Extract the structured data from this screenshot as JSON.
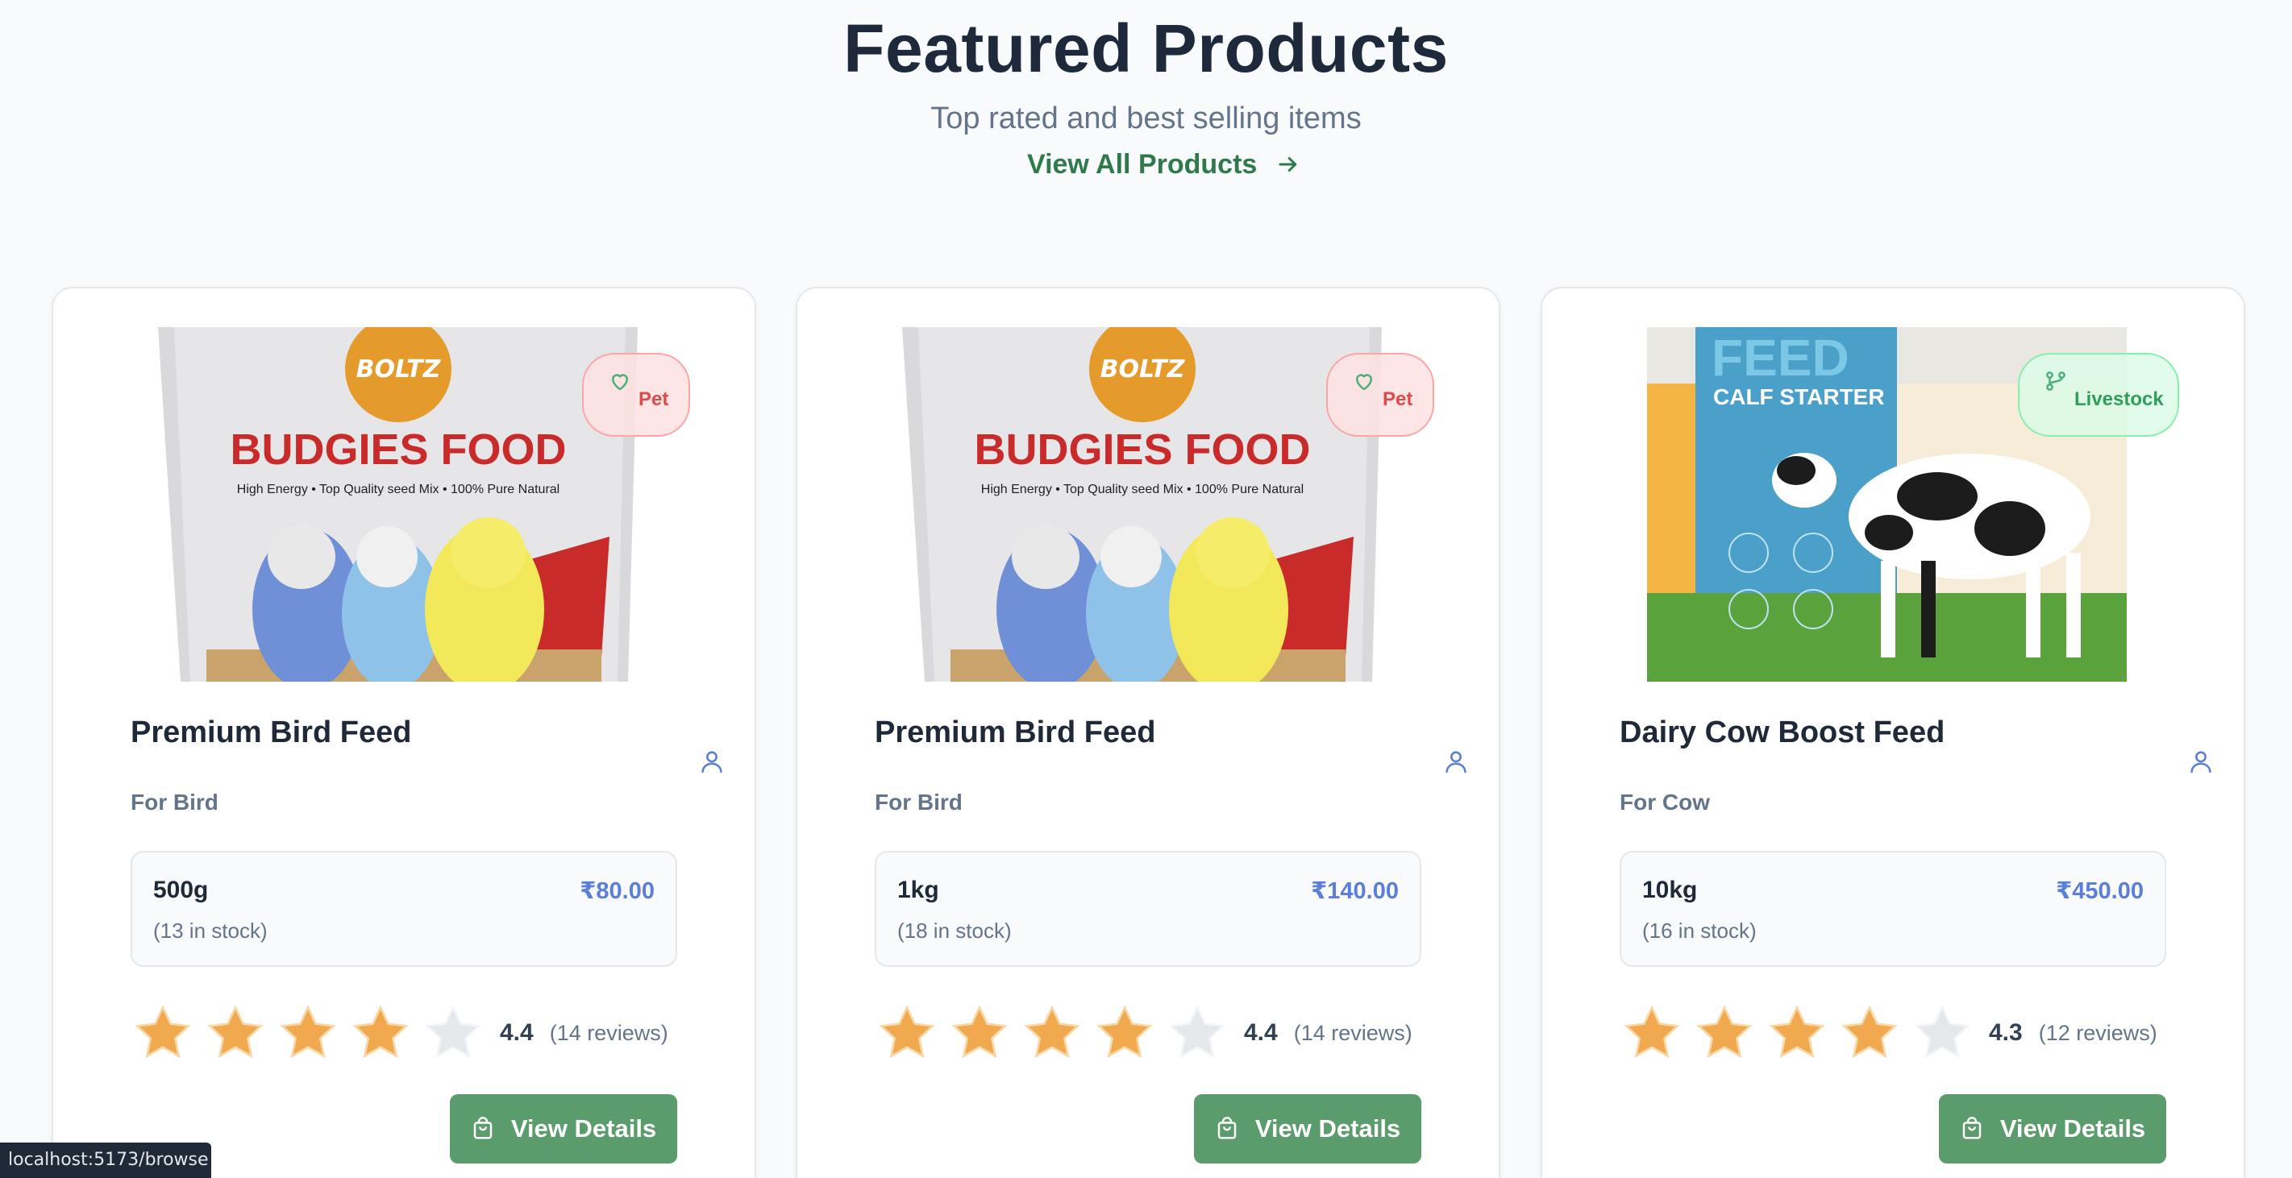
{
  "header": {
    "title": "Featured Products",
    "subtitle": "Top rated and best selling items",
    "view_all_label": "View All Products"
  },
  "products": [
    {
      "image": "budgies-food-bag",
      "image_texts": [
        "BOLTZ",
        "BUDGIES FOOD",
        "High Energy •  Top Quality seed Mix • 100% Pure Natural"
      ],
      "category": "Pet",
      "category_icon": "heart-icon",
      "name": "Premium Bird Feed",
      "for_label": "For Bird",
      "variant": {
        "size": "500g",
        "price": "₹80.00",
        "stock": "(13 in stock)"
      },
      "rating": {
        "stars": 4,
        "max": 5,
        "value": "4.4",
        "count": "(14 reviews)"
      },
      "button_label": "View Details"
    },
    {
      "image": "budgies-food-bag",
      "image_texts": [
        "BOLTZ",
        "BUDGIES FOOD",
        "High Energy •  Top Quality seed Mix • 100% Pure Natural"
      ],
      "category": "Pet",
      "category_icon": "heart-icon",
      "name": "Premium Bird Feed",
      "for_label": "For Bird",
      "variant": {
        "size": "1kg",
        "price": "₹140.00",
        "stock": "(18 in stock)"
      },
      "rating": {
        "stars": 4,
        "max": 5,
        "value": "4.4",
        "count": "(14 reviews)"
      },
      "button_label": "View Details"
    },
    {
      "image": "calf-starter-feed",
      "image_texts": [
        "FEED",
        "CALF STARTER"
      ],
      "category": "Livestock",
      "category_icon": "branch-icon",
      "name": "Dairy Cow Boost Feed",
      "for_label": "For Cow",
      "variant": {
        "size": "10kg",
        "price": "₹450.00",
        "stock": "(16 in stock)"
      },
      "rating": {
        "stars": 4,
        "max": 5,
        "value": "4.3",
        "count": "(12 reviews)"
      },
      "button_label": "View Details"
    }
  ],
  "status_bar": {
    "url": "localhost:5173/browse"
  },
  "colors": {
    "accent_green": "#5a9c6b",
    "price_blue": "#5b7fd8",
    "star_fill": "#f0a94e",
    "star_empty": "#e5e7eb",
    "pet_badge": "#fee2e2",
    "livestock_badge": "#dcfce7"
  }
}
